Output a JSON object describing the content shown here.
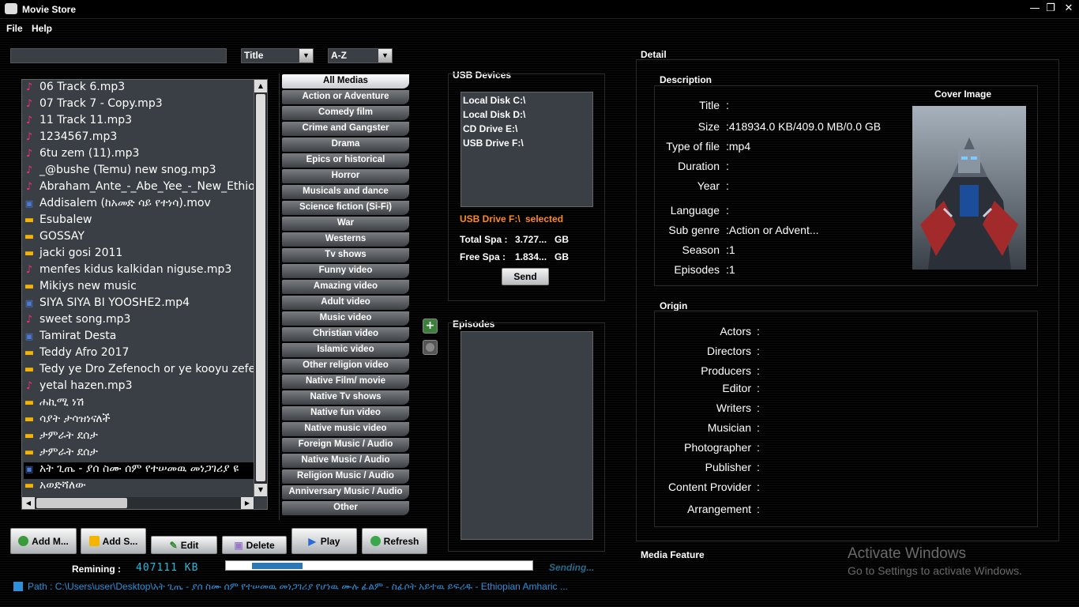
{
  "window": {
    "title": "Movie Store"
  },
  "menu": {
    "file": "File",
    "help": "Help"
  },
  "search": {
    "value": ""
  },
  "sort_field": {
    "selected": "Title"
  },
  "sort_order": {
    "selected": "A-Z"
  },
  "files": [
    {
      "icon": "music-note-icon",
      "name": "06 Track 6.mp3"
    },
    {
      "icon": "music-note-icon",
      "name": "07 Track 7 - Copy.mp3"
    },
    {
      "icon": "music-note-icon",
      "name": "11 Track 11.mp3"
    },
    {
      "icon": "music-note-icon",
      "name": "1234567.mp3"
    },
    {
      "icon": "music-note-icon",
      "name": "6tu zem (11).mp3"
    },
    {
      "icon": "music-note-icon",
      "name": "_@bushe (Temu) new snog.mp3"
    },
    {
      "icon": "music-note-icon",
      "name": "Abraham_Ante_-_Abe_Yee_-_New_Ethiop"
    },
    {
      "icon": "film-icon",
      "name": "Addisalem (ከአመድ ሳይ የተነሳ).mov"
    },
    {
      "icon": "folder-icon",
      "name": "Esubalew"
    },
    {
      "icon": "folder-icon",
      "name": "GOSSAY"
    },
    {
      "icon": "folder-icon",
      "name": "jacki gosi 2011"
    },
    {
      "icon": "music-note-icon",
      "name": "menfes kidus kalkidan niguse.mp3"
    },
    {
      "icon": "folder-icon",
      "name": "Mikiys new music"
    },
    {
      "icon": "film-icon",
      "name": "SIYA SIYA BI YOOSHE2.mp4"
    },
    {
      "icon": "music-note-icon",
      "name": "sweet song.mp3"
    },
    {
      "icon": "film-icon",
      "name": "Tamirat Desta"
    },
    {
      "icon": "folder-icon",
      "name": "Teddy Afro 2017"
    },
    {
      "icon": "folder-icon",
      "name": "Tedy ye Dro Zefenoch or ye kooyu zefe"
    },
    {
      "icon": "music-note-icon",
      "name": "yetal hazen.mp3"
    },
    {
      "icon": "folder-icon",
      "name": "ሐኪሚ ነሽ"
    },
    {
      "icon": "folder-icon",
      "name": "ሳያት ታሳዝነናለች"
    },
    {
      "icon": "folder-icon",
      "name": "ታምራት ደሰታ"
    },
    {
      "icon": "folder-icon",
      "name": "ታምራት ደሰታ"
    },
    {
      "icon": "film-icon",
      "name": "አት ጊጤ - ያሰ ስሙ ሰም የተሠመዉ መነጋገሪያ ዩ"
    },
    {
      "icon": "folder-icon",
      "name": "አወድሻለው"
    }
  ],
  "selected_file_index": 23,
  "categories": [
    "All Medias",
    "Action or Adventure",
    "Comedy film",
    "Crime and Gangster",
    "Drama",
    "Epics or historical",
    "Horror",
    "Musicals and dance",
    "Science fiction (Si-Fi)",
    "War",
    "Westerns",
    "Tv shows",
    "Funny video",
    "Amazing video",
    "Adult video",
    "Music video",
    "Christian video",
    "Islamic video",
    "Other religion video",
    "Native  Film/ movie",
    "Native Tv shows",
    "Native fun video",
    "Native music video",
    "Foreign Music / Audio",
    "Native Music / Audio",
    "Religion Music / Audio",
    "Anniversary Music / Audio",
    "Other"
  ],
  "usb": {
    "title": "USB Devices",
    "drives": [
      "Local Disk C:\\",
      "Local Disk D:\\",
      "CD Drive E:\\",
      "USB Drive F:\\"
    ],
    "selected_drive": "USB Drive F:\\",
    "selected_label": "selected",
    "total_label": "Total Spa :",
    "total_value": "3.727...",
    "free_label": "Free Spa :",
    "free_value": "1.834...",
    "unit": "GB",
    "send_label": "Send"
  },
  "episodes": {
    "title": "Episodes"
  },
  "buttons": {
    "add_media": "Add M...",
    "add_series": "Add S...",
    "edit": "Edit",
    "delete": "Delete",
    "play": "Play",
    "refresh": "Refresh"
  },
  "status": {
    "remaining_label": "Remining :",
    "remaining_value": "407111 KB",
    "progress": 0.165,
    "sending": "Sending...",
    "path": "Path : C:\\Users\\user\\Desktop\\አት ጊጤ - ያሰ ስሙ ሰም የተሠመዉ መነጋገሪያ የሆነዉ ሙሉ ፊልም - ስፊሶት አይተዉ ይፍሪዱ - Ethiopian Amharic ..."
  },
  "detail": {
    "title": "Detail",
    "description_title": "Description",
    "cover_title": "Cover Image",
    "fields": [
      {
        "label": "Title",
        "value": ":"
      },
      {
        "label": "Size",
        "value": ":418934.0 KB/409.0 MB/0.0 GB"
      },
      {
        "label": "Type of file",
        "value": ":mp4"
      },
      {
        "label": "Duration",
        "value": ":"
      },
      {
        "label": "Year",
        "value": ":"
      },
      {
        "label": "Language",
        "value": ":"
      },
      {
        "label": "Sub genre",
        "value": ":Action or Advent..."
      },
      {
        "label": "Season",
        "value": ":1"
      },
      {
        "label": "Episodes",
        "value": ":1"
      }
    ],
    "origin_title": "Origin",
    "origin_fields": [
      {
        "label": "Actors",
        "value": ":"
      },
      {
        "label": "Directors",
        "value": ":"
      },
      {
        "label": "Producers",
        "value": ":"
      },
      {
        "label": "Editor",
        "value": ":"
      },
      {
        "label": "Writers",
        "value": ":"
      },
      {
        "label": "Musician",
        "value": ":"
      },
      {
        "label": "Photographer",
        "value": ":"
      },
      {
        "label": "Publisher",
        "value": ":"
      },
      {
        "label": "Content Provider",
        "value": ":"
      },
      {
        "label": "Arrangement",
        "value": ":"
      }
    ],
    "media_feature_title": "Media Feature"
  },
  "watermark": {
    "line1": "Activate Windows",
    "line2": "Go to Settings to activate Windows."
  },
  "colors": {
    "accent_orange": "#ff8a1e",
    "path_blue": "#2f8fd8",
    "music_pink": "#ff2d7a",
    "folder_yellow": "#f5b400"
  }
}
